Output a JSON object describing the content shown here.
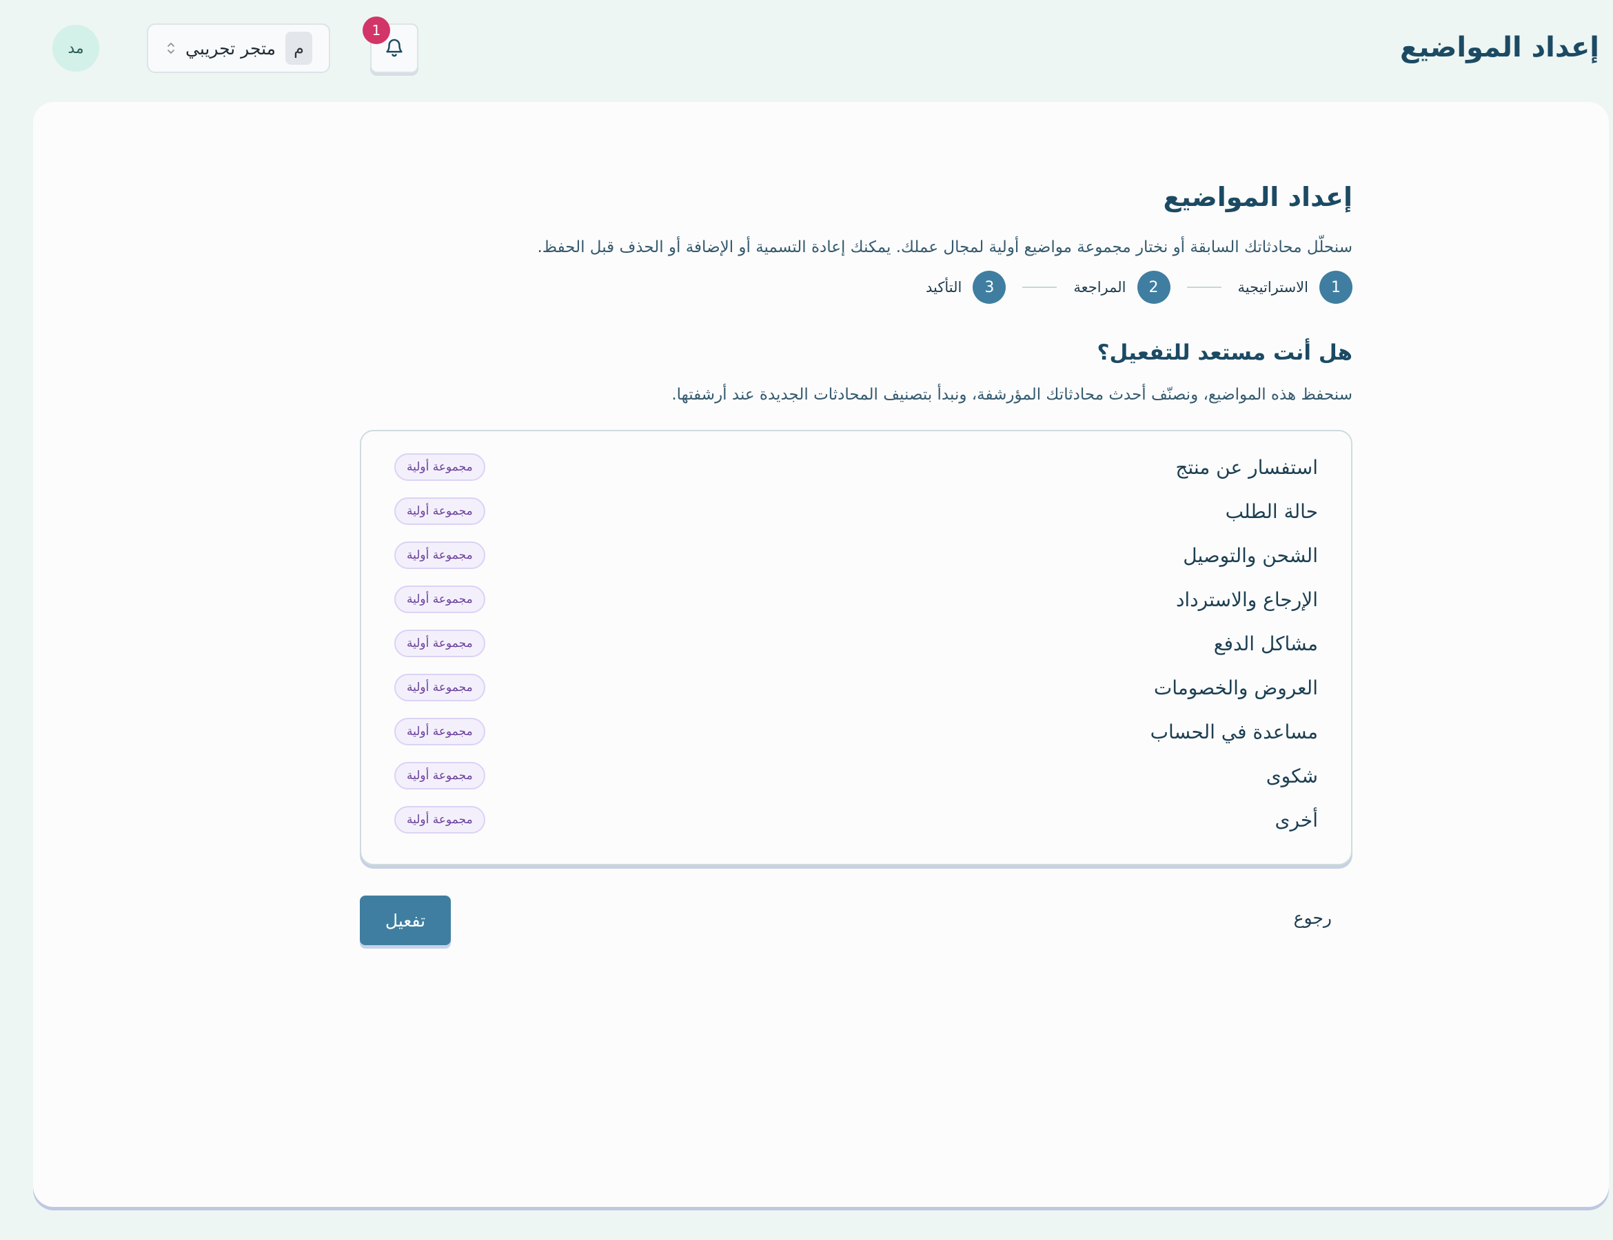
{
  "header": {
    "title": "إعداد المواضيع",
    "avatar_initials": "مد",
    "store": {
      "badge": "م",
      "name": "متجر تجريبي",
      "chevron_icon": "chevron-up-down-icon"
    },
    "notifications": {
      "icon": "bell-icon",
      "count": "1"
    }
  },
  "page": {
    "title": "إعداد المواضيع",
    "description": "سنحلّل محادثاتك السابقة أو نختار مجموعة مواضيع أولية لمجال عملك. يمكنك إعادة التسمية أو الإضافة أو الحذف قبل الحفظ."
  },
  "stepper": {
    "steps": [
      {
        "number": "1",
        "label": "الاستراتيجية"
      },
      {
        "number": "2",
        "label": "المراجعة"
      },
      {
        "number": "3",
        "label": "التأكيد"
      }
    ],
    "current_step": 3
  },
  "section": {
    "title": "هل أنت مستعد للتفعيل؟",
    "description": "سنحفظ هذه المواضيع، ونصنّف أحدث محادثاتك المؤرشفة، ونبدأ بتصنيف المحادثات الجديدة عند أرشفتها."
  },
  "topics": [
    {
      "name": "استفسار عن منتج",
      "tag": "مجموعة أولية"
    },
    {
      "name": "حالة الطلب",
      "tag": "مجموعة أولية"
    },
    {
      "name": "الشحن والتوصيل",
      "tag": "مجموعة أولية"
    },
    {
      "name": "الإرجاع والاسترداد",
      "tag": "مجموعة أولية"
    },
    {
      "name": "مشاكل الدفع",
      "tag": "مجموعة أولية"
    },
    {
      "name": "العروض والخصومات",
      "tag": "مجموعة أولية"
    },
    {
      "name": "مساعدة في الحساب",
      "tag": "مجموعة أولية"
    },
    {
      "name": "شكوى",
      "tag": "مجموعة أولية"
    },
    {
      "name": "أخرى",
      "tag": "مجموعة أولية"
    }
  ],
  "actions": {
    "back_label": "رجوع",
    "activate_label": "تفعيل"
  },
  "colors": {
    "background": "#edf6f3",
    "primary": "#3f7ea0",
    "notification": "#d23567",
    "tag_bg": "#f3f0fc",
    "tag_text": "#6a3f9a"
  }
}
